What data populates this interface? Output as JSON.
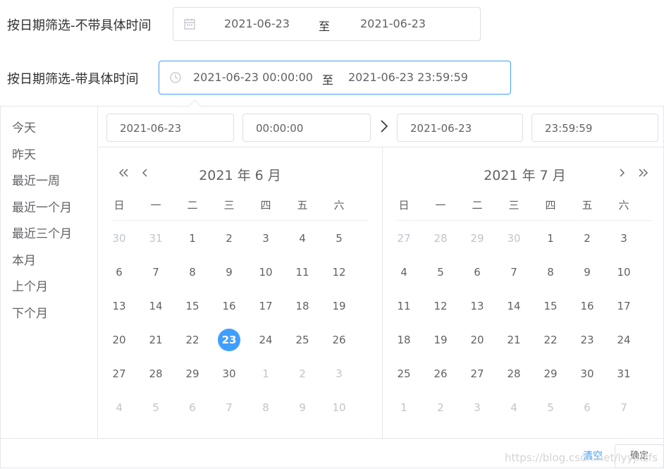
{
  "filters": {
    "label_no_time": "按日期筛选-不带具体时间",
    "range1": {
      "start": "2021-06-23",
      "separator": "至",
      "end": "2021-06-23"
    },
    "label_with_time": "按日期筛选-带具体时间",
    "range2": {
      "start": "2021-06-23 00:00:00",
      "separator": "至",
      "end": "2021-06-23 23:59:59"
    }
  },
  "picker": {
    "shortcuts": [
      "今天",
      "昨天",
      "最近一周",
      "最近一个月",
      "最近三个月",
      "本月",
      "上个月",
      "下个月"
    ],
    "start_date": "2021-06-23",
    "start_time": "00:00:00",
    "end_date": "2021-06-23",
    "end_time": "23:59:59",
    "weekdays": [
      "日",
      "一",
      "二",
      "三",
      "四",
      "五",
      "六"
    ],
    "left_title": "2021 年 6 月",
    "right_title": "2021 年 7 月",
    "left_days": [
      [
        "30",
        "31",
        "1",
        "2",
        "3",
        "4",
        "5"
      ],
      [
        "6",
        "7",
        "8",
        "9",
        "10",
        "11",
        "12"
      ],
      [
        "13",
        "14",
        "15",
        "16",
        "17",
        "18",
        "19"
      ],
      [
        "20",
        "21",
        "22",
        "23",
        "24",
        "25",
        "26"
      ],
      [
        "27",
        "28",
        "29",
        "30",
        "1",
        "2",
        "3"
      ],
      [
        "4",
        "5",
        "6",
        "7",
        "8",
        "9",
        "10"
      ]
    ],
    "left_muted_before": 2,
    "left_muted_after_index": 32,
    "selected_index": 24,
    "right_days": [
      [
        "27",
        "28",
        "29",
        "30",
        "1",
        "2",
        "3"
      ],
      [
        "4",
        "5",
        "6",
        "7",
        "8",
        "9",
        "10"
      ],
      [
        "11",
        "12",
        "13",
        "14",
        "15",
        "16",
        "17"
      ],
      [
        "18",
        "19",
        "20",
        "21",
        "22",
        "23",
        "24"
      ],
      [
        "25",
        "26",
        "27",
        "28",
        "29",
        "30",
        "31"
      ],
      [
        "1",
        "2",
        "3",
        "4",
        "5",
        "6",
        "7"
      ]
    ],
    "right_muted_before": 4,
    "right_muted_after_index": 35,
    "clear_label": "清空",
    "confirm_label": "确定",
    "accent": "#409eff"
  },
  "watermark": "https://blog.csdn.net/lyyjhzfs"
}
